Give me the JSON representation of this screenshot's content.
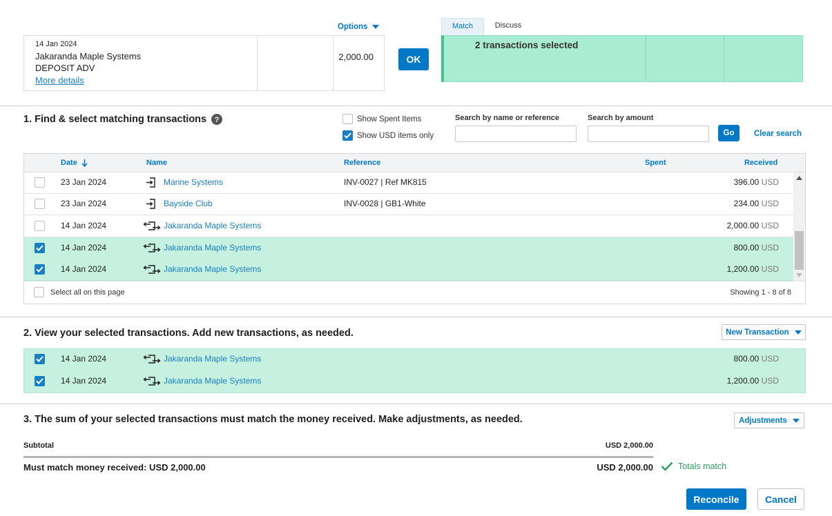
{
  "statement": {
    "date": "14 Jan 2024",
    "payee": "Jakaranda Maple Systems",
    "description": "DEPOSIT ADV",
    "more_details": "More details",
    "amount": "2,000.00",
    "options_label": "Options"
  },
  "ok_label": "OK",
  "tabs": [
    {
      "label": "Match",
      "active": true
    },
    {
      "label": "Discuss",
      "active": false
    }
  ],
  "match_panel": {
    "text": "2 transactions selected"
  },
  "section1": {
    "title": "1. Find & select matching transactions",
    "show_spent_label": "Show Spent Items",
    "show_spent_checked": false,
    "show_usd_label": "Show USD items only",
    "show_usd_checked": true,
    "search_name_label": "Search by name or reference",
    "search_name_value": "",
    "search_amount_label": "Search by amount",
    "search_amount_value": "",
    "go_label": "Go",
    "clear_search_label": "Clear search"
  },
  "table": {
    "columns": {
      "date": "Date",
      "name": "Name",
      "reference": "Reference",
      "spent": "Spent",
      "received": "Received"
    },
    "rows": [
      {
        "date": "23 Jan 2024",
        "icon": "invoice-icon",
        "name": "Marine Systems",
        "reference": "INV-0027 | Ref MK815",
        "amount": "396.00",
        "currency": "USD",
        "checked": false
      },
      {
        "date": "23 Jan 2024",
        "icon": "invoice-icon",
        "name": "Bayside Club",
        "reference": "INV-0028 | GB1-White",
        "amount": "234.00",
        "currency": "USD",
        "checked": false
      },
      {
        "date": "14 Jan 2024",
        "icon": "transfer-icon",
        "name": "Jakaranda Maple Systems",
        "reference": "",
        "amount": "2,000.00",
        "currency": "USD",
        "checked": false
      },
      {
        "date": "14 Jan 2024",
        "icon": "transfer-icon",
        "name": "Jakaranda Maple Systems",
        "reference": "",
        "amount": "800.00",
        "currency": "USD",
        "checked": true
      },
      {
        "date": "14 Jan 2024",
        "icon": "transfer-icon",
        "name": "Jakaranda Maple Systems",
        "reference": "",
        "amount": "1,200.00",
        "currency": "USD",
        "checked": true
      }
    ],
    "select_all_label": "Select all on this page",
    "showing": "Showing 1 - 8 of 8"
  },
  "section2": {
    "title": "2. View your selected transactions. Add new transactions, as needed.",
    "new_transaction_label": "New Transaction",
    "rows": [
      {
        "date": "14 Jan 2024",
        "name": "Jakaranda Maple Systems",
        "amount": "800.00",
        "currency": "USD"
      },
      {
        "date": "14 Jan 2024",
        "name": "Jakaranda Maple Systems",
        "amount": "1,200.00",
        "currency": "USD"
      }
    ]
  },
  "section3": {
    "title": "3. The sum of your selected transactions must match the money received. Make adjustments, as needed.",
    "adjustments_label": "Adjustments",
    "subtotal_label": "Subtotal",
    "subtotal_value": "USD 2,000.00",
    "must_match_label": "Must match money received: USD 2,000.00",
    "must_match_value": "USD 2,000.00",
    "totals_match_label": "Totals match"
  },
  "buttons": {
    "reconcile": "Reconcile",
    "cancel": "Cancel"
  },
  "colors": {
    "accent": "#0078c8",
    "selected_row": "#c6f1e0",
    "match_panel": "#a8ecd4",
    "success": "#2e9d5f"
  }
}
